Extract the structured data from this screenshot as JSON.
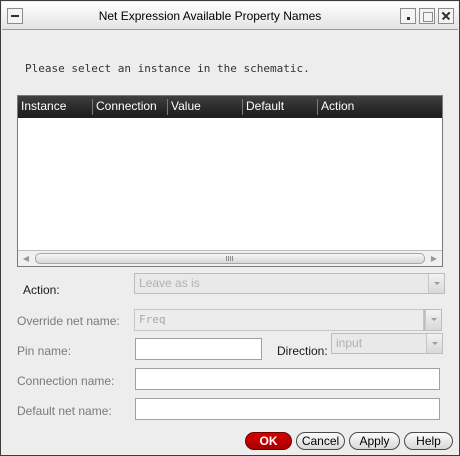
{
  "window": {
    "title": "Net Expression Available Property Names"
  },
  "prompt": "Please select an instance in the schematic.",
  "table": {
    "columns": [
      "Instance",
      "Connection",
      "Value",
      "Default",
      "Action"
    ],
    "rows": []
  },
  "form": {
    "action": {
      "label": "Action:",
      "value": "Leave as is"
    },
    "override_net_name": {
      "label": "Override net name:",
      "value": "Freq"
    },
    "pin_name": {
      "label": "Pin name:",
      "value": ""
    },
    "direction": {
      "label": "Direction:",
      "value": "input"
    },
    "connection_name": {
      "label": "Connection name:",
      "value": ""
    },
    "default_net_name": {
      "label": "Default net name:",
      "value": ""
    }
  },
  "buttons": {
    "ok": "OK",
    "cancel": "Cancel",
    "apply": "Apply",
    "help": "Help"
  },
  "colors": {
    "ok_button": "#c00000",
    "table_header": "#2a2a2a",
    "dialog_background": "#ededed"
  }
}
